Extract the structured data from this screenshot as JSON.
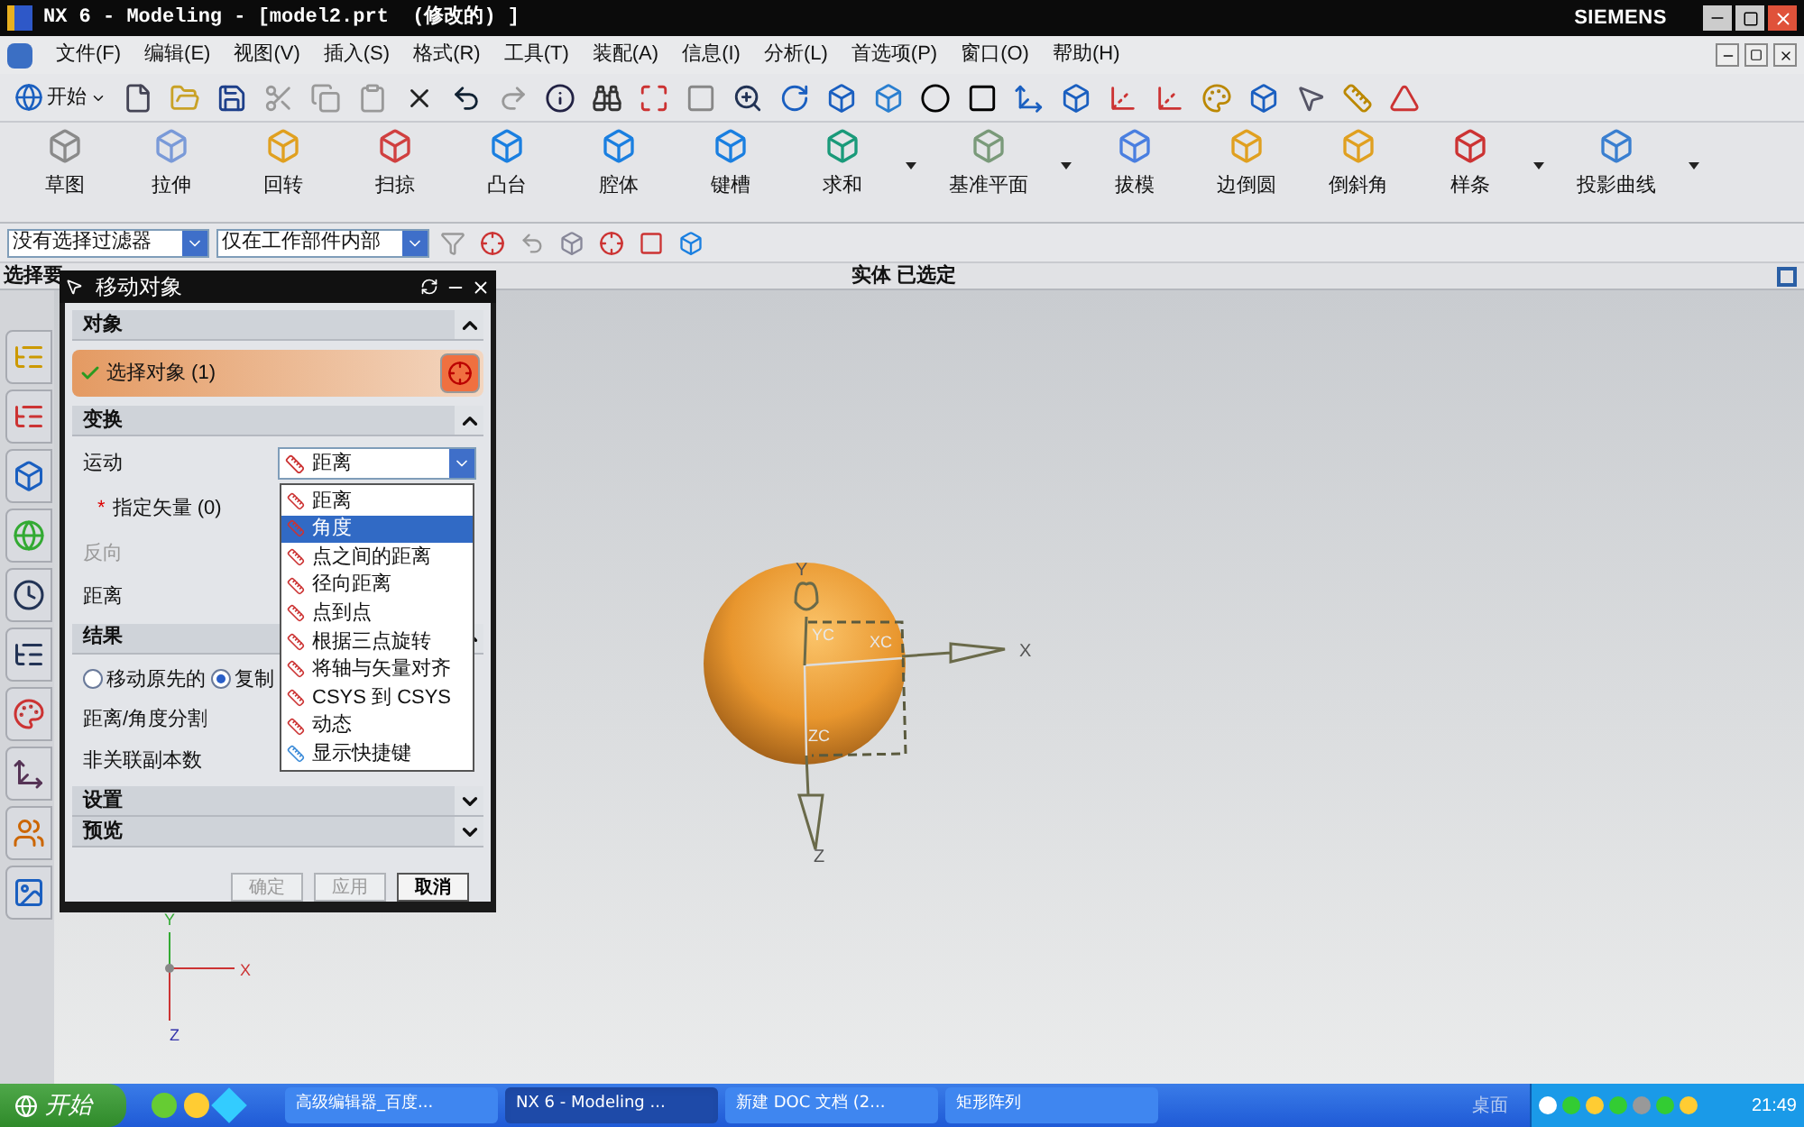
{
  "window": {
    "title": "NX 6 - Modeling - [model2.prt  (修改的) ]",
    "brand": "SIEMENS"
  },
  "menu": [
    "文件(F)",
    "编辑(E)",
    "视图(V)",
    "插入(S)",
    "格式(R)",
    "工具(T)",
    "装配(A)",
    "信息(I)",
    "分析(L)",
    "首选项(P)",
    "窗口(O)",
    "帮助(H)"
  ],
  "standard_toolbar": {
    "start_label": "开始"
  },
  "feature_toolbar": [
    {
      "label": "草图",
      "dropdown": false
    },
    {
      "label": "拉伸",
      "dropdown": false
    },
    {
      "label": "回转",
      "dropdown": false
    },
    {
      "label": "扫掠",
      "dropdown": false
    },
    {
      "label": "凸台",
      "dropdown": false
    },
    {
      "label": "腔体",
      "dropdown": false
    },
    {
      "label": "键槽",
      "dropdown": false
    },
    {
      "label": "求和",
      "dropdown": true
    },
    {
      "label": "基准平面",
      "dropdown": true
    },
    {
      "label": "拔模",
      "dropdown": false
    },
    {
      "label": "边倒圆",
      "dropdown": false
    },
    {
      "label": "倒斜角",
      "dropdown": false
    },
    {
      "label": "样条",
      "dropdown": true
    },
    {
      "label": "投影曲线",
      "dropdown": true
    }
  ],
  "selection_bar": {
    "filter": "没有选择过滤器",
    "scope": "仅在工作部件内部"
  },
  "status_bar": {
    "prompt": "选择要",
    "status": "实体 已选定"
  },
  "dialog": {
    "title": "移动对象",
    "sections": [
      {
        "title": "对象",
        "expanded": true
      },
      {
        "title": "变换",
        "expanded": true
      },
      {
        "title": "结果",
        "expanded": true
      },
      {
        "title": "设置",
        "expanded": false
      },
      {
        "title": "预览",
        "expanded": false
      }
    ],
    "select_object": "选择对象 (1)",
    "motion_label": "运动",
    "motion_value": "距离",
    "vector_marker": "*",
    "vector_label": "指定矢量 (0)",
    "reverse_label": "反向",
    "reverse_disabled": true,
    "distance_label": "距离",
    "result_options": [
      {
        "label": "移动原先的",
        "selected": false
      },
      {
        "label": "复制",
        "selected": true
      }
    ],
    "split_label": "距离/角度分割",
    "copies_label": "非关联副本数",
    "buttons": [
      {
        "label": "确定",
        "disabled": true
      },
      {
        "label": "应用",
        "disabled": true
      },
      {
        "label": "取消",
        "disabled": false
      }
    ]
  },
  "motion_dropdown": [
    {
      "label": "距离",
      "selected": false
    },
    {
      "label": "角度",
      "selected": true
    },
    {
      "label": "点之间的距离",
      "selected": false
    },
    {
      "label": "径向距离",
      "selected": false
    },
    {
      "label": "点到点",
      "selected": false
    },
    {
      "label": "根据三点旋转",
      "selected": false
    },
    {
      "label": "将轴与矢量对齐",
      "selected": false
    },
    {
      "label": "CSYS 到 CSYS",
      "selected": false
    },
    {
      "label": "动态",
      "selected": false
    },
    {
      "label": "显示快捷键",
      "selected": false
    }
  ],
  "viewport": {
    "axis_labels": [
      "Y",
      "X",
      "Z"
    ],
    "csys_labels": [
      "YC",
      "XC",
      "ZC"
    ],
    "triad_labels": [
      "Y",
      "X",
      "Z"
    ]
  },
  "taskbar": {
    "start": "开始",
    "tasks": [
      {
        "label": "高级编辑器_百度...",
        "selected": false
      },
      {
        "label": "NX 6 - Modeling ...",
        "selected": true
      },
      {
        "label": "新建 DOC 文档 (2...",
        "selected": false
      },
      {
        "label": "矩形阵列",
        "selected": false
      }
    ],
    "desktop": "桌面",
    "clock": "21:49"
  }
}
